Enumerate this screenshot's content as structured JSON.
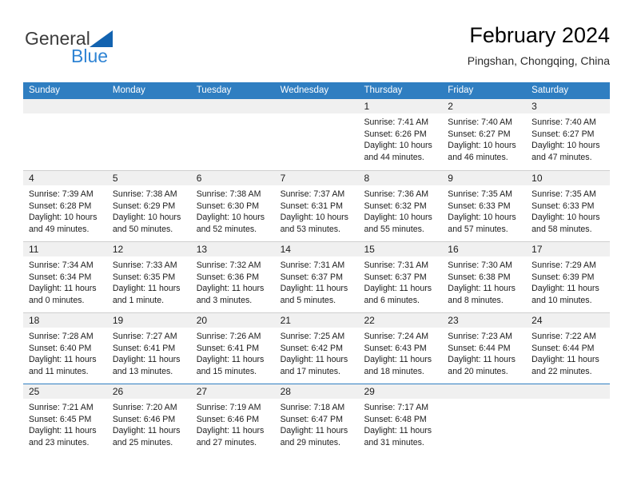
{
  "brand": {
    "name_top": "General",
    "name_bottom": "Blue",
    "triangle_color": "#1263b0",
    "text_color": "#3c3c3c",
    "blue_color": "#2f84d4"
  },
  "header": {
    "title": "February 2024",
    "subtitle": "Pingshan, Chongqing, China"
  },
  "theme": {
    "header_bg": "#2f7ec1",
    "header_text": "#ffffff",
    "day_band_bg": "#f0f0f0",
    "grid_line": "#cfcfcf"
  },
  "weekdays": [
    "Sunday",
    "Monday",
    "Tuesday",
    "Wednesday",
    "Thursday",
    "Friday",
    "Saturday"
  ],
  "weeks": [
    [
      {
        "day": "",
        "lines": []
      },
      {
        "day": "",
        "lines": []
      },
      {
        "day": "",
        "lines": []
      },
      {
        "day": "",
        "lines": []
      },
      {
        "day": "1",
        "lines": [
          "Sunrise: 7:41 AM",
          "Sunset: 6:26 PM",
          "Daylight: 10 hours",
          "and 44 minutes."
        ]
      },
      {
        "day": "2",
        "lines": [
          "Sunrise: 7:40 AM",
          "Sunset: 6:27 PM",
          "Daylight: 10 hours",
          "and 46 minutes."
        ]
      },
      {
        "day": "3",
        "lines": [
          "Sunrise: 7:40 AM",
          "Sunset: 6:27 PM",
          "Daylight: 10 hours",
          "and 47 minutes."
        ]
      }
    ],
    [
      {
        "day": "4",
        "lines": [
          "Sunrise: 7:39 AM",
          "Sunset: 6:28 PM",
          "Daylight: 10 hours",
          "and 49 minutes."
        ]
      },
      {
        "day": "5",
        "lines": [
          "Sunrise: 7:38 AM",
          "Sunset: 6:29 PM",
          "Daylight: 10 hours",
          "and 50 minutes."
        ]
      },
      {
        "day": "6",
        "lines": [
          "Sunrise: 7:38 AM",
          "Sunset: 6:30 PM",
          "Daylight: 10 hours",
          "and 52 minutes."
        ]
      },
      {
        "day": "7",
        "lines": [
          "Sunrise: 7:37 AM",
          "Sunset: 6:31 PM",
          "Daylight: 10 hours",
          "and 53 minutes."
        ]
      },
      {
        "day": "8",
        "lines": [
          "Sunrise: 7:36 AM",
          "Sunset: 6:32 PM",
          "Daylight: 10 hours",
          "and 55 minutes."
        ]
      },
      {
        "day": "9",
        "lines": [
          "Sunrise: 7:35 AM",
          "Sunset: 6:33 PM",
          "Daylight: 10 hours",
          "and 57 minutes."
        ]
      },
      {
        "day": "10",
        "lines": [
          "Sunrise: 7:35 AM",
          "Sunset: 6:33 PM",
          "Daylight: 10 hours",
          "and 58 minutes."
        ]
      }
    ],
    [
      {
        "day": "11",
        "lines": [
          "Sunrise: 7:34 AM",
          "Sunset: 6:34 PM",
          "Daylight: 11 hours",
          "and 0 minutes."
        ]
      },
      {
        "day": "12",
        "lines": [
          "Sunrise: 7:33 AM",
          "Sunset: 6:35 PM",
          "Daylight: 11 hours",
          "and 1 minute."
        ]
      },
      {
        "day": "13",
        "lines": [
          "Sunrise: 7:32 AM",
          "Sunset: 6:36 PM",
          "Daylight: 11 hours",
          "and 3 minutes."
        ]
      },
      {
        "day": "14",
        "lines": [
          "Sunrise: 7:31 AM",
          "Sunset: 6:37 PM",
          "Daylight: 11 hours",
          "and 5 minutes."
        ]
      },
      {
        "day": "15",
        "lines": [
          "Sunrise: 7:31 AM",
          "Sunset: 6:37 PM",
          "Daylight: 11 hours",
          "and 6 minutes."
        ]
      },
      {
        "day": "16",
        "lines": [
          "Sunrise: 7:30 AM",
          "Sunset: 6:38 PM",
          "Daylight: 11 hours",
          "and 8 minutes."
        ]
      },
      {
        "day": "17",
        "lines": [
          "Sunrise: 7:29 AM",
          "Sunset: 6:39 PM",
          "Daylight: 11 hours",
          "and 10 minutes."
        ]
      }
    ],
    [
      {
        "day": "18",
        "lines": [
          "Sunrise: 7:28 AM",
          "Sunset: 6:40 PM",
          "Daylight: 11 hours",
          "and 11 minutes."
        ]
      },
      {
        "day": "19",
        "lines": [
          "Sunrise: 7:27 AM",
          "Sunset: 6:41 PM",
          "Daylight: 11 hours",
          "and 13 minutes."
        ]
      },
      {
        "day": "20",
        "lines": [
          "Sunrise: 7:26 AM",
          "Sunset: 6:41 PM",
          "Daylight: 11 hours",
          "and 15 minutes."
        ]
      },
      {
        "day": "21",
        "lines": [
          "Sunrise: 7:25 AM",
          "Sunset: 6:42 PM",
          "Daylight: 11 hours",
          "and 17 minutes."
        ]
      },
      {
        "day": "22",
        "lines": [
          "Sunrise: 7:24 AM",
          "Sunset: 6:43 PM",
          "Daylight: 11 hours",
          "and 18 minutes."
        ]
      },
      {
        "day": "23",
        "lines": [
          "Sunrise: 7:23 AM",
          "Sunset: 6:44 PM",
          "Daylight: 11 hours",
          "and 20 minutes."
        ]
      },
      {
        "day": "24",
        "lines": [
          "Sunrise: 7:22 AM",
          "Sunset: 6:44 PM",
          "Daylight: 11 hours",
          "and 22 minutes."
        ]
      }
    ],
    [
      {
        "day": "25",
        "lines": [
          "Sunrise: 7:21 AM",
          "Sunset: 6:45 PM",
          "Daylight: 11 hours",
          "and 23 minutes."
        ]
      },
      {
        "day": "26",
        "lines": [
          "Sunrise: 7:20 AM",
          "Sunset: 6:46 PM",
          "Daylight: 11 hours",
          "and 25 minutes."
        ]
      },
      {
        "day": "27",
        "lines": [
          "Sunrise: 7:19 AM",
          "Sunset: 6:46 PM",
          "Daylight: 11 hours",
          "and 27 minutes."
        ]
      },
      {
        "day": "28",
        "lines": [
          "Sunrise: 7:18 AM",
          "Sunset: 6:47 PM",
          "Daylight: 11 hours",
          "and 29 minutes."
        ]
      },
      {
        "day": "29",
        "lines": [
          "Sunrise: 7:17 AM",
          "Sunset: 6:48 PM",
          "Daylight: 11 hours",
          "and 31 minutes."
        ]
      },
      {
        "day": "",
        "lines": []
      },
      {
        "day": "",
        "lines": []
      }
    ]
  ]
}
